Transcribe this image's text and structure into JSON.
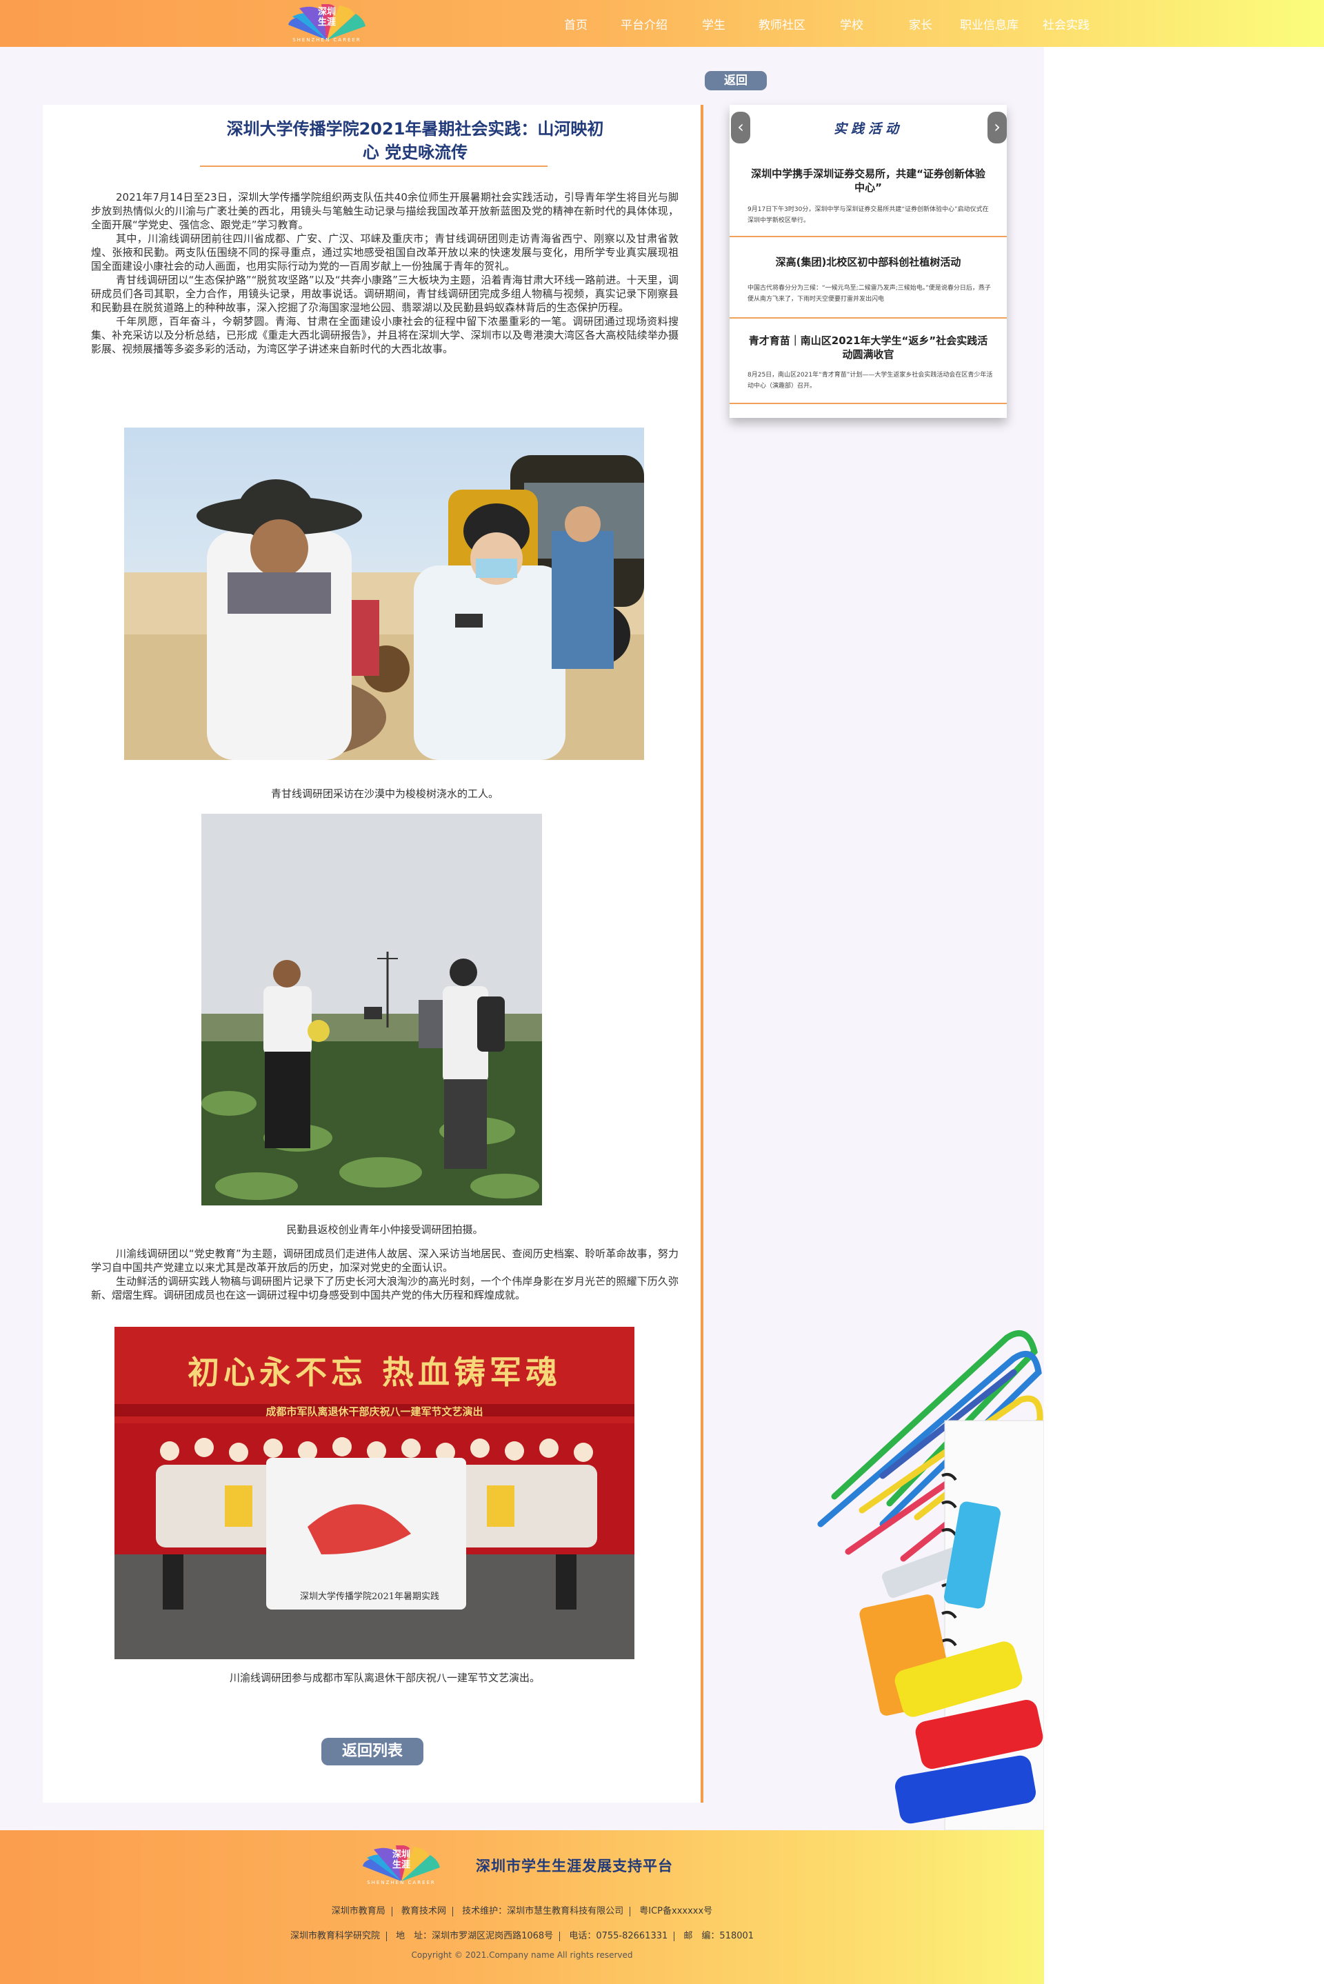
{
  "header": {
    "logo_cn_line1": "深圳",
    "logo_cn_line2": "生涯",
    "logo_en": "SHENZHEN CAREER",
    "nav": [
      "首页",
      "平台介绍",
      "学生",
      "教师社区",
      "学校",
      "家长",
      "职业信息库",
      "社会实践"
    ]
  },
  "back_top_label": "返回",
  "article": {
    "title": "深圳大学传播学院2021年暑期社会实践：山河映初心 党史咏流传",
    "paragraphs_block1": [
      "2021年7月14日至23日，深圳大学传播学院组织两支队伍共40余位师生开展暑期社会实践活动，引导青年学生将目光与脚步放到热情似火的川渝与广袤壮美的西北，用镜头与笔触生动记录与描绘我国改革开放新蓝图及党的精神在新时代的具体体现，全面开展“学党史、强信念、跟党走”学习教育。",
      "其中，川渝线调研团前往四川省成都、广安、广汉、邛崃及重庆市；青甘线调研团则走访青海省西宁、刚察以及甘肃省敦煌、张掖和民勤。两支队伍围绕不同的探寻重点，通过实地感受祖国自改革开放以来的快速发展与变化，用所学专业真实展现祖国全面建设小康社会的动人画面，也用实际行动为党的一百周岁献上一份独属于青年的贺礼。",
      "青甘线调研团以“生态保护路”“脱贫攻坚路”以及“共奔小康路”三大板块为主题，沿着青海甘肃大环线一路前进。十天里，调研成员们各司其职，全力合作，用镜头记录，用故事说话。调研期间，青甘线调研团完成多组人物稿与视频，真实记录下刚察县和民勤县在脱贫道路上的种种故事，深入挖掘了尕海国家湿地公园、翡翠湖以及民勤县蚂蚁森林背后的生态保护历程。",
      "千年夙愿，百年奋斗，今朝梦圆。青海、甘肃在全面建设小康社会的征程中留下浓墨重彩的一笔。调研团通过现场资料搜集、补充采访以及分析总结，已形成《重走大西北调研报告》，并且将在深圳大学、深圳市以及粤港澳大湾区各大高校陆续举办摄影展、视频展播等多姿多彩的活动，为湾区学子讲述来自新时代的大西北故事。"
    ],
    "caption1": "青甘线调研团采访在沙漠中为梭梭树浇水的工人。",
    "caption2": "民勤县返校创业青年小仲接受调研团拍摄。",
    "paragraphs_block2": [
      "川渝线调研团以“党史教育”为主题，调研团成员们走进伟人故居、深入采访当地居民、查阅历史档案、聆听革命故事，努力学习自中国共产党建立以来尤其是改革开放后的历史，加深对党史的全面认识。",
      "生动鲜活的调研实践人物稿与调研图片记录下了历史长河大浪淘沙的高光时刻，一个个伟岸身影在岁月光芒的照耀下历久弥新、熠熠生辉。调研团成员也在这一调研过程中切身感受到中国共产党的伟大历程和辉煌成就。"
    ],
    "caption3": "川渝线调研团参与成都市军队离退休干部庆祝八一建军节文艺演出。",
    "photo3_banner_text": "初心永不忘 热血铸军魂",
    "photo3_sub_banner": "成都市军队离退休干部庆祝八一建军节文艺演出",
    "photo3_flag_text": "深圳大学传播学院2021年暑期实践",
    "back_list_label": "返回列表"
  },
  "sidebar": {
    "title": "实践活动",
    "prev_icon": "chevron-left-icon",
    "next_icon": "chevron-right-icon",
    "items": [
      {
        "title": "深圳中学携手深圳证券交易所，共建“证券创新体验中心”",
        "desc": "9月17日下午3时30分，深圳中学与深圳证券交易所共建“证券创新体验中心”启动仪式在深圳中学新校区举行。"
      },
      {
        "title": "深高(集团)北校区初中部科创社植树活动",
        "desc": "中国古代将春分分为三候：“一候元鸟至;二候雷乃发声;三候始电。”便是说春分日后，燕子便从南方飞来了，下雨时天空便要打雷并发出闪电"
      },
      {
        "title": "青才育苗｜南山区2021年大学生“返乡”社会实践活动圆满收官",
        "desc": "8月25日，南山区2021年“青才育苗”计划——大学生返家乡社会实践活动会在区青少年活动中心（演趣部）召开。"
      }
    ]
  },
  "footer": {
    "platform_title": "深圳市学生生涯发展支持平台",
    "line1": [
      "深圳市教育局",
      "教育技术网",
      "技术维护：深圳市慧生教育科技有限公司",
      "粤ICP备xxxxxx号"
    ],
    "line2": [
      "深圳市教育科学研究院",
      "地　址：深圳市罗湖区泥岗西路1068号",
      "电话：0755-82661331",
      "邮　编：518001"
    ],
    "copyright": "Copyright © 2021.Company name All rights reserved"
  },
  "colors": {
    "brand_navy": "#213a7a",
    "accent_orange": "#f59c4b",
    "button_slate": "#6b7f9f"
  }
}
